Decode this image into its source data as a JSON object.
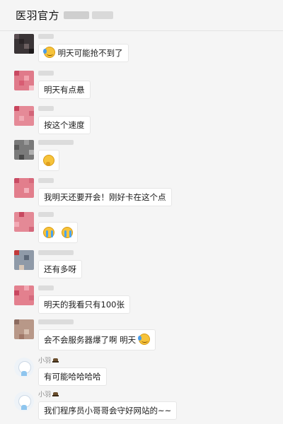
{
  "chat": {
    "title": "医羽官方"
  },
  "messages": [
    {
      "sender": "",
      "text": "明天可能抢不到了",
      "emoji_before": "sweat-emoji"
    },
    {
      "sender": "",
      "text": "明天有点悬"
    },
    {
      "sender": "",
      "text": "按这个速度"
    },
    {
      "sender": "",
      "text": "",
      "emoji_only": [
        "thinking-emoji"
      ]
    },
    {
      "sender": "",
      "text": "我明天还要开会！刚好卡在这个点"
    },
    {
      "sender": "",
      "text": "",
      "emoji_only": [
        "crying-emoji",
        "crying-emoji"
      ]
    },
    {
      "sender": "",
      "text": "还有多呀"
    },
    {
      "sender": "",
      "text": "明天的我看只有100张"
    },
    {
      "sender": "",
      "text": "会不会服务器爆了啊 明天",
      "emoji_after": "sweat-emoji"
    },
    {
      "sender": "小羽",
      "text": "有可能哈哈哈哈"
    },
    {
      "sender": "小羽",
      "text": "我们程序员小哥哥会守好网站的~~"
    }
  ],
  "colors": {
    "background": "#f5f5f5",
    "bubble": "#ffffff",
    "header_border": "#e4e4e4"
  }
}
